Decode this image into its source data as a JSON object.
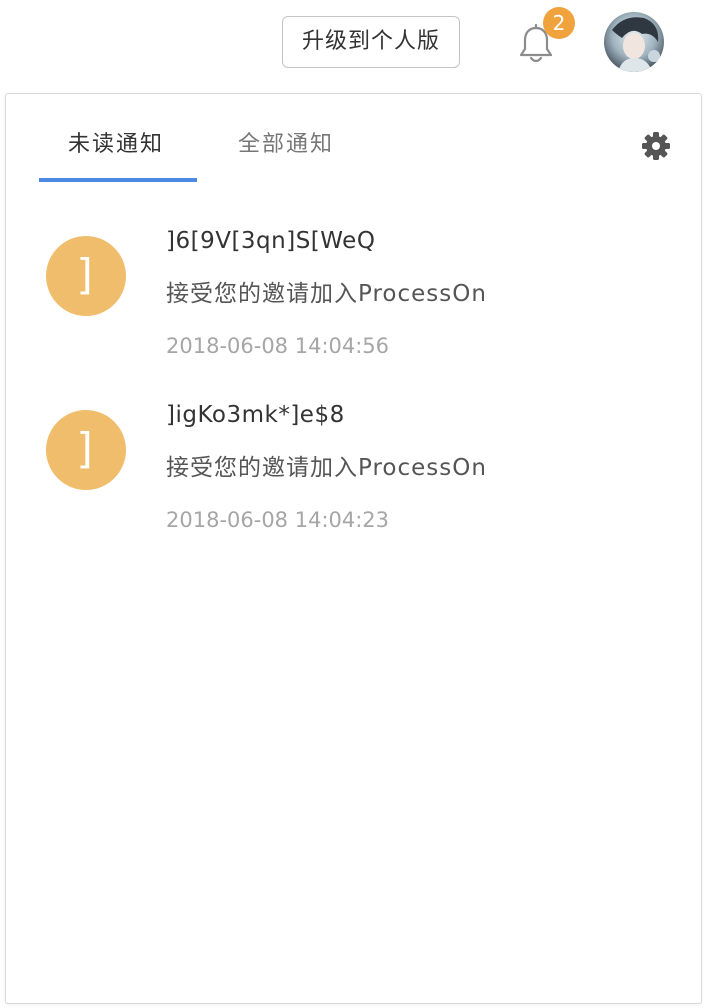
{
  "header": {
    "upgrade_label": "升级到个人版",
    "notification_count": "2",
    "bell_icon": "bell-icon",
    "avatar_icon": "user-avatar",
    "badge_color": "#f0a23c"
  },
  "panel": {
    "tabs": [
      {
        "label": "未读通知",
        "active": true
      },
      {
        "label": "全部通知",
        "active": false
      }
    ],
    "settings_icon": "gear-icon",
    "accent_color": "#4c89e3",
    "notifications": [
      {
        "avatar_letter": "]",
        "name": "]6[9V[3qn]S[WeQ",
        "message": "接受您的邀请加入ProcessOn",
        "time": "2018-06-08 14:04:56"
      },
      {
        "avatar_letter": "]",
        "name": "]igKo3mk*]e$8",
        "message": "接受您的邀请加入ProcessOn",
        "time": "2018-06-08 14:04:23"
      }
    ]
  }
}
